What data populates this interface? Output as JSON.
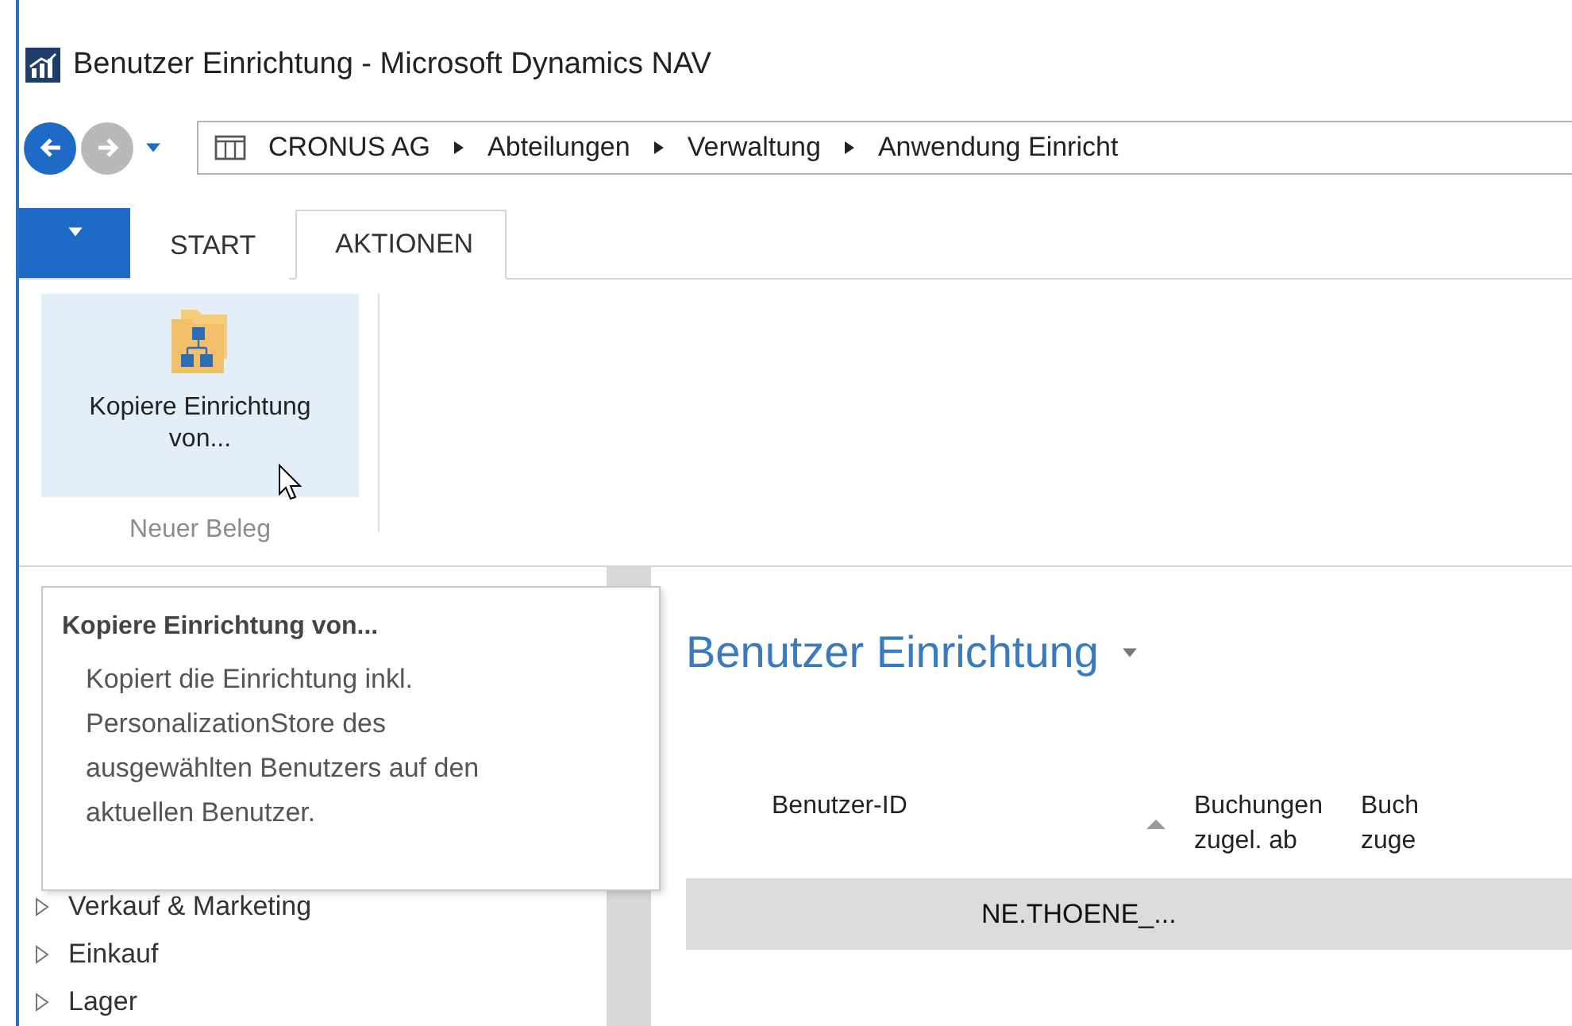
{
  "window": {
    "title": "Benutzer Einrichtung - Microsoft Dynamics NAV"
  },
  "breadcrumb": [
    "CRONUS AG",
    "Abteilungen",
    "Verwaltung",
    "Anwendung Einricht"
  ],
  "tabs": [
    {
      "label": "START",
      "selected": false
    },
    {
      "label": "AKTIONEN",
      "selected": true
    }
  ],
  "ribbon": {
    "buttons": [
      {
        "label": "Kopiere Einrichtung von...",
        "highlighted": true
      }
    ],
    "group": "Neuer Beleg"
  },
  "tooltip": {
    "title": "Kopiere Einrichtung von...",
    "text": "Kopiert die Einrichtung inkl. PersonalizationStore des ausgewählten Benutzers auf den aktuellen Benutzer."
  },
  "navigation": {
    "items": [
      {
        "label": "Verkauf & Marketing",
        "expanded": false
      },
      {
        "label": "Einkauf",
        "expanded": false
      },
      {
        "label": "Lager",
        "expanded": false
      }
    ]
  },
  "page": {
    "title": "Benutzer Einrichtung"
  },
  "table": {
    "columns": [
      {
        "label": "Benutzer-ID",
        "sorted": true
      },
      {
        "label": "Buchungen zugel. ab",
        "sorted": false
      },
      {
        "label": "Buch zuge",
        "sorted": false
      }
    ],
    "rows": [
      {
        "cells": [
          "NE.THOENE_..."
        ],
        "selected": true
      }
    ]
  }
}
